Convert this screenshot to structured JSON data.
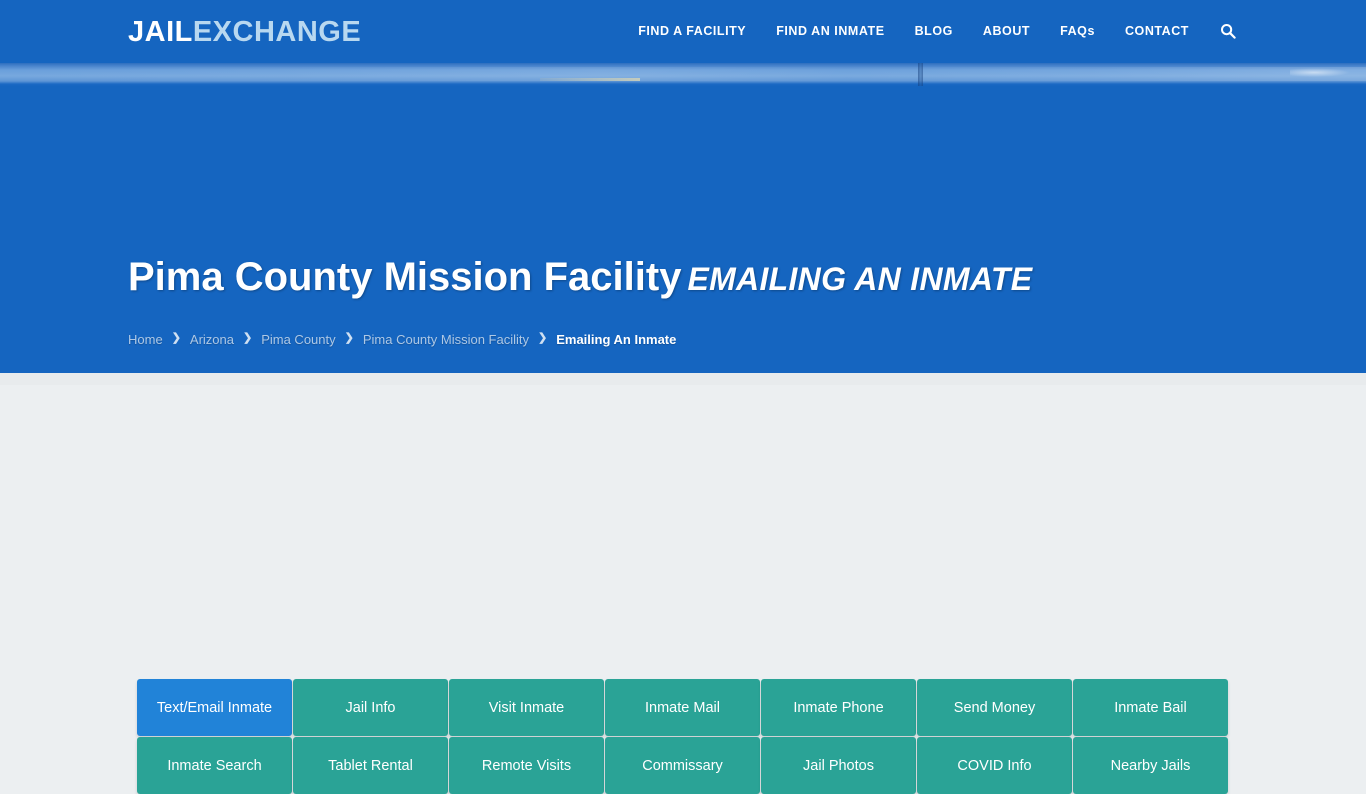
{
  "header": {
    "logo": {
      "part1": "JAIL",
      "part2": "EXCHANGE"
    },
    "nav": [
      {
        "label": "FIND A FACILITY"
      },
      {
        "label": "FIND AN INMATE"
      },
      {
        "label": "BLOG"
      },
      {
        "label": "ABOUT"
      },
      {
        "label": "FAQs"
      },
      {
        "label": "CONTACT"
      }
    ],
    "search_icon": "search-icon"
  },
  "hero": {
    "title_main": "Pima County Mission Facility",
    "title_suffix": "EMAILING AN INMATE",
    "breadcrumb": [
      {
        "label": "Home",
        "current": false
      },
      {
        "label": "Arizona",
        "current": false
      },
      {
        "label": "Pima County",
        "current": false
      },
      {
        "label": "Pima County Mission Facility",
        "current": false
      },
      {
        "label": "Emailing An Inmate",
        "current": true
      }
    ],
    "separator": "❯"
  },
  "facility_nav": {
    "buttons": [
      {
        "label": "Text/Email Inmate",
        "active": true
      },
      {
        "label": "Jail Info",
        "active": false
      },
      {
        "label": "Visit Inmate",
        "active": false
      },
      {
        "label": "Inmate Mail",
        "active": false
      },
      {
        "label": "Inmate Phone",
        "active": false
      },
      {
        "label": "Send Money",
        "active": false
      },
      {
        "label": "Inmate Bail",
        "active": false
      },
      {
        "label": "Inmate Search",
        "active": false
      },
      {
        "label": "Tablet Rental",
        "active": false
      },
      {
        "label": "Remote Visits",
        "active": false
      },
      {
        "label": "Commissary",
        "active": false
      },
      {
        "label": "Jail Photos",
        "active": false
      },
      {
        "label": "COVID Info",
        "active": false
      },
      {
        "label": "Nearby Jails",
        "active": false
      }
    ]
  },
  "colors": {
    "brand_blue": "#1565c0",
    "accent_teal": "#2aa396",
    "active_blue": "#2183d8",
    "page_bg": "#eceff1"
  }
}
